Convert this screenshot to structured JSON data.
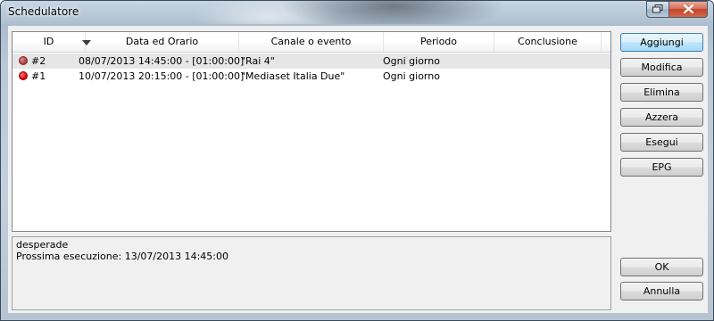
{
  "window": {
    "title": "Schedulatore"
  },
  "list": {
    "columns": [
      "ID",
      "Data ed Orario",
      "Canale o evento",
      "Periodo",
      "Conclusione"
    ],
    "sort_column": "Data ed Orario",
    "sort_direction": "descending",
    "rows": [
      {
        "status": "inactive",
        "status_color": "#b84040",
        "id": "#2",
        "datetime": "08/07/2013 14:45:00 - [01:00:00]",
        "channel": "\"Rai 4\"",
        "period": "Ogni giorno",
        "end": "",
        "selected": true
      },
      {
        "status": "active",
        "status_color": "#e00000",
        "id": "#1",
        "datetime": "10/07/2013 20:15:00 - [01:00:00]",
        "channel": "\"Mediaset Italia Due\"",
        "period": "Ogni giorno",
        "end": "",
        "selected": false
      }
    ]
  },
  "details": {
    "line1": "desperade",
    "line2": "Prossima esecuzione: 13/07/2013 14:45:00"
  },
  "buttons": {
    "add": "Aggiungi",
    "edit": "Modifica",
    "delete": "Elimina",
    "reset": "Azzera",
    "run": "Esegui",
    "epg": "EPG",
    "ok": "OK",
    "cancel": "Annulla"
  },
  "icons": {
    "restore": "restore-icon",
    "close": "close-icon",
    "sort": "sort-descending-icon",
    "status": "status-dot-icon"
  }
}
